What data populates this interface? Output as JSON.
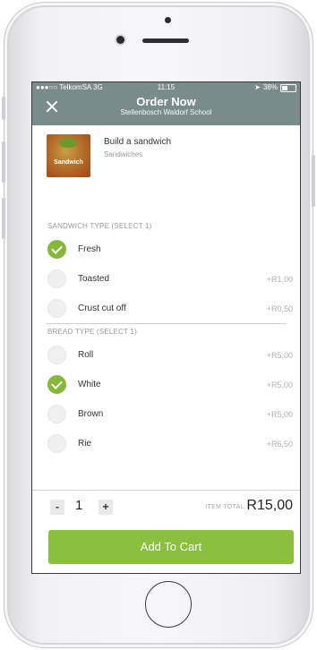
{
  "status_bar": {
    "carrier": "●●●○○ TelkomSA  3G",
    "time": "11:15",
    "battery": "38%"
  },
  "header": {
    "title": "Order Now",
    "subtitle": "Stellenbosch Waldorf School"
  },
  "product": {
    "name": "Build a sandwich",
    "category": "Sandwiches",
    "thumbnail_label": "Sandwich"
  },
  "sections": [
    {
      "title": "SANDWICH TYPE (SELECT 1)",
      "options": [
        {
          "label": "Fresh",
          "price": "",
          "selected": true
        },
        {
          "label": "Toasted",
          "price": "+R1,00",
          "selected": false
        },
        {
          "label": "Crust cut off",
          "price": "+R0,50",
          "selected": false
        }
      ]
    },
    {
      "title": "BREAD TYPE (SELECT 1)",
      "options": [
        {
          "label": "Roll",
          "price": "+R5,00",
          "selected": false
        },
        {
          "label": "White",
          "price": "+R5,00",
          "selected": true
        },
        {
          "label": "Brown",
          "price": "+R5,00",
          "selected": false
        },
        {
          "label": "Rie",
          "price": "+R6,50",
          "selected": false
        }
      ]
    }
  ],
  "footer": {
    "minus": "-",
    "quantity": "1",
    "plus": "+",
    "total_label": "ITEM TOTAL:",
    "total_value": "R15,00",
    "add_to_cart": "Add To Cart"
  },
  "colors": {
    "accent": "#8bbf3e",
    "header_bg": "#7a8b8c"
  }
}
